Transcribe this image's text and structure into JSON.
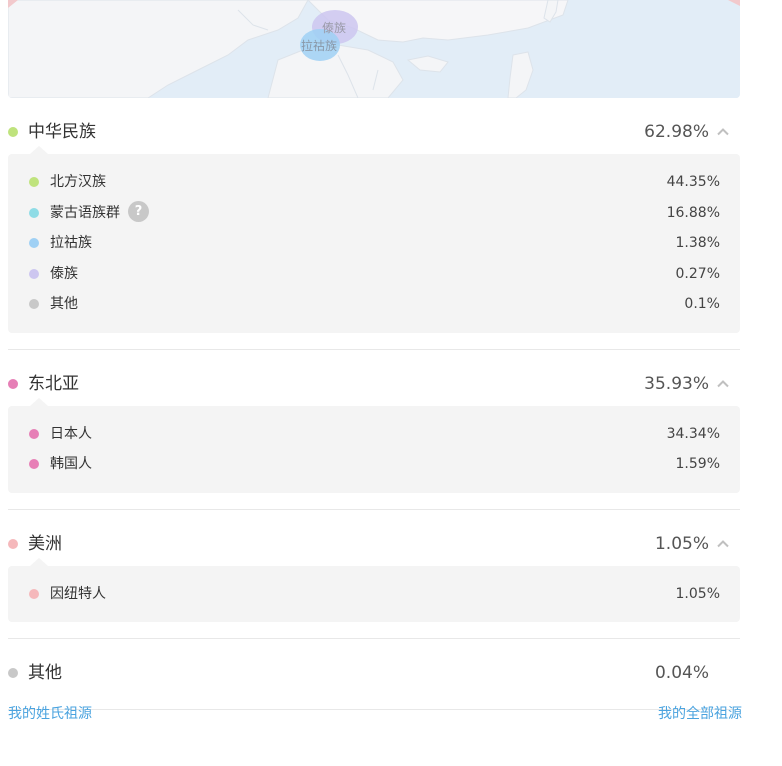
{
  "map": {
    "labels": [
      "傣族",
      "拉祜族"
    ]
  },
  "colors": {
    "han_north": "#bfe37d",
    "mongol": "#8fdce6",
    "lahu": "#9fd0f4",
    "dai": "#cdc6f0",
    "other": "#c8c8c8",
    "japanese": "#e67fb6",
    "korean": "#e77fb6",
    "newyork": "#f5b8bb",
    "chevron": "#c0c0c0",
    "link": "#4aa3df"
  },
  "groups": [
    {
      "name": "中华民族",
      "pct": "62.98%",
      "items": [
        {
          "name": "北方汉族",
          "pct": "44.35%"
        },
        {
          "name": "蒙古语族群",
          "pct": "16.88%",
          "help": "?"
        },
        {
          "name": "拉祜族",
          "pct": "1.38%"
        },
        {
          "name": "傣族",
          "pct": "0.27%"
        },
        {
          "name": "其他",
          "pct": "0.1%"
        }
      ]
    },
    {
      "name": "东北亚",
      "pct": "35.93%",
      "items": [
        {
          "name": "日本人",
          "pct": "34.34%"
        },
        {
          "name": "韩国人",
          "pct": "1.59%"
        }
      ]
    },
    {
      "name": "美洲",
      "pct": "1.05%",
      "items": [
        {
          "name": "因纽特人",
          "pct": "1.05%"
        }
      ]
    },
    {
      "name": "其他",
      "pct": "0.04%",
      "items": []
    }
  ],
  "footer": {
    "left_link": "我的姓氏祖源",
    "right_link": "我的全部祖源"
  }
}
